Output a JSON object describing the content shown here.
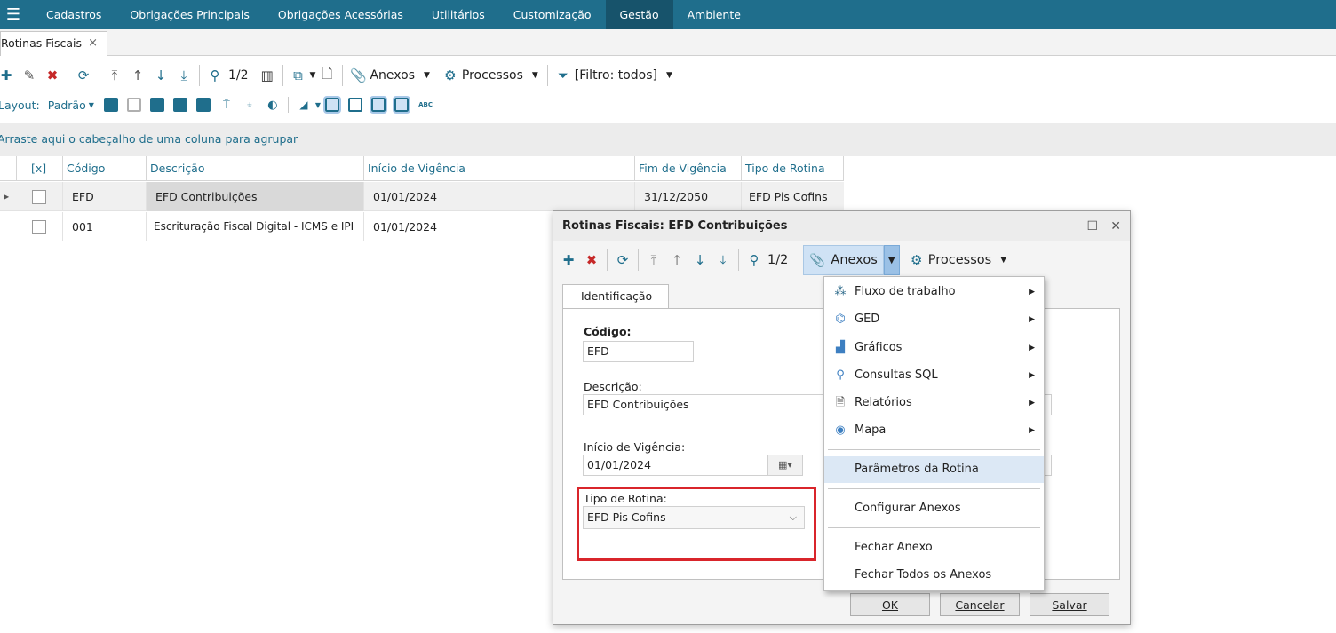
{
  "app": {
    "menu": [
      "Cadastros",
      "Obrigações Principais",
      "Obrigações Acessórias",
      "Utilitários",
      "Customização",
      "Gestão",
      "Ambiente"
    ],
    "active_menu": "Gestão"
  },
  "tab": {
    "label": "Rotinas Fiscais",
    "close": "×"
  },
  "toolbar": {
    "page": "1/2",
    "anexos": "Anexos",
    "processos": "Processos",
    "filter": "[Filtro: todos]"
  },
  "layout_bar": {
    "label": "Layout:",
    "preset": "Padrão"
  },
  "group_hint": "Arraste aqui o cabeçalho de uma coluna para agrupar",
  "grid": {
    "columns": [
      "[x]",
      "Código",
      "Descrição",
      "Início de Vigência",
      "Fim de Vigência",
      "Tipo de Rotina"
    ],
    "rows": [
      {
        "codigo": "EFD",
        "descricao": "EFD Contribuições",
        "inicio": "01/01/2024",
        "fim": "31/12/2050",
        "tipo": "EFD Pis Cofins"
      },
      {
        "codigo": "001",
        "descricao": "Escrituração Fiscal Digital - ICMS e IPI",
        "inicio": "01/01/2024",
        "fim": "",
        "tipo": ""
      }
    ]
  },
  "dialog": {
    "title": "Rotinas Fiscais: EFD Contribuições",
    "page": "1/2",
    "anexos": "Anexos",
    "processos": "Processos",
    "tab": "Identificação",
    "codigo_label": "Código",
    "codigo_value": "EFD",
    "descricao_label": "Descrição:",
    "descricao_value": "EFD Contribuições",
    "inicio_label": "Início de Vigência:",
    "inicio_value": "01/01/2024",
    "tipo_label": "Tipo de Rotina:",
    "tipo_value": "EFD Pis Cofins",
    "ok": "OK",
    "cancelar": "Cancelar",
    "salvar": "Salvar"
  },
  "anexos_menu": {
    "items": [
      {
        "label": "Fluxo de trabalho",
        "icon": "workflow-icon",
        "submenu": true
      },
      {
        "label": "GED",
        "icon": "ged-icon",
        "submenu": true
      },
      {
        "label": "Gráficos",
        "icon": "chart-icon",
        "submenu": true
      },
      {
        "label": "Consultas SQL",
        "icon": "search-icon",
        "submenu": true
      },
      {
        "label": "Relatórios",
        "icon": "report-icon",
        "submenu": true
      },
      {
        "label": "Mapa",
        "icon": "map-pin-icon",
        "submenu": true
      },
      {
        "label": "Parâmetros da Rotina",
        "icon": "",
        "submenu": false
      },
      {
        "label": "Configurar Anexos",
        "icon": "",
        "submenu": false
      },
      {
        "label": "Fechar Anexo",
        "icon": "",
        "submenu": false
      },
      {
        "label": "Fechar Todos os Anexos",
        "icon": "",
        "submenu": false
      }
    ]
  },
  "colors": {
    "brand": "#1f6e8c",
    "highlight_box": "#d9252b",
    "menu_hover": "#dce8f5"
  }
}
